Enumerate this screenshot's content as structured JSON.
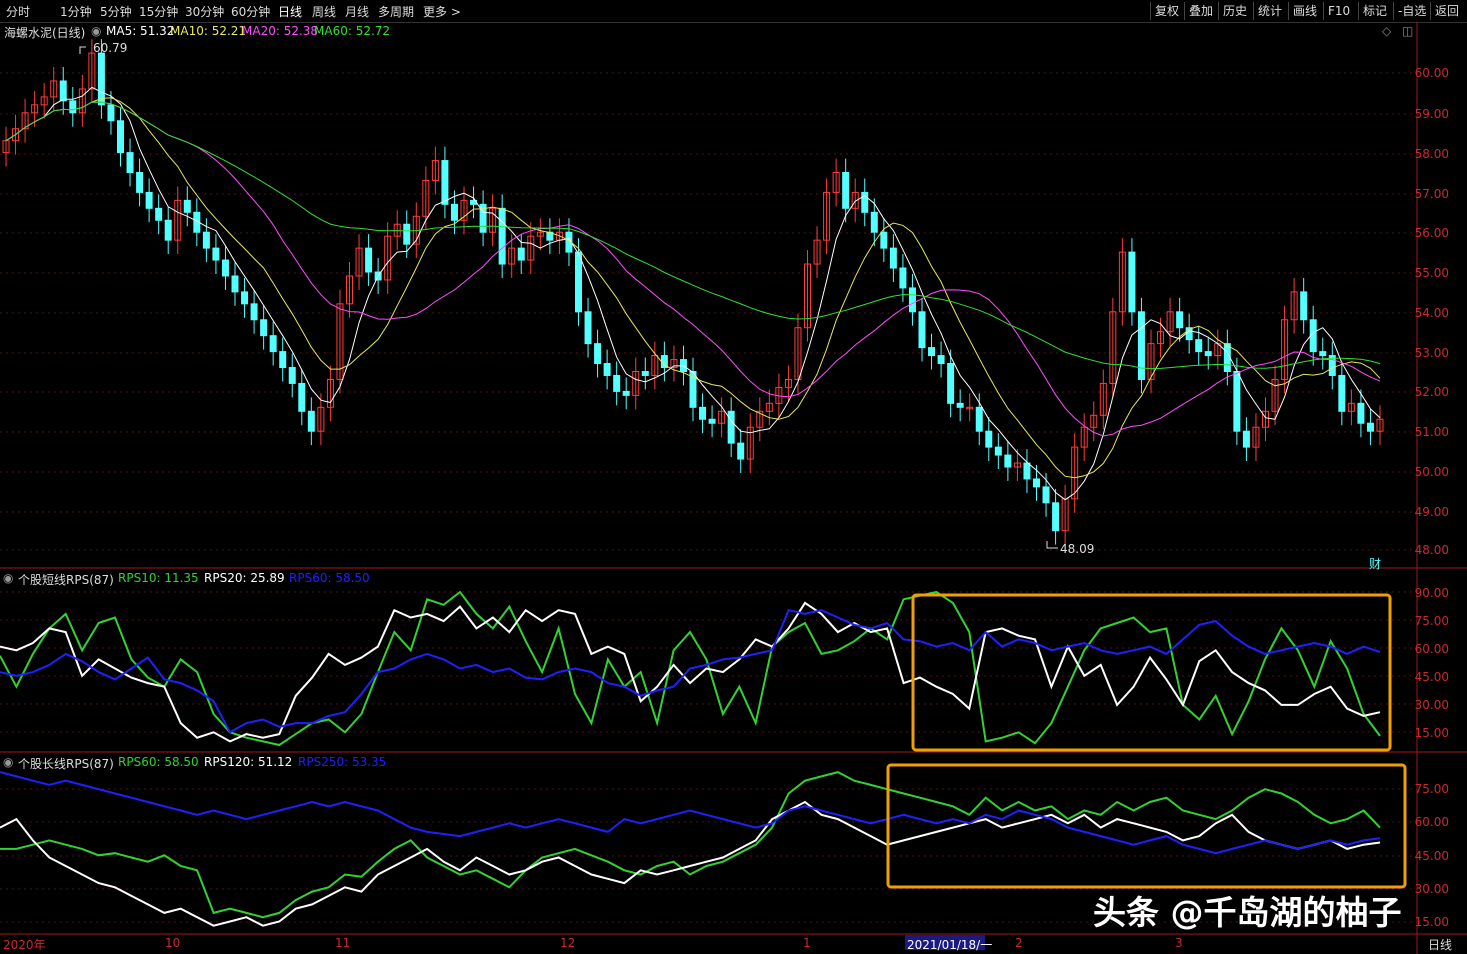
{
  "toolbar": {
    "periods": [
      "分时",
      "1分钟",
      "5分钟",
      "15分钟",
      "30分钟",
      "60分钟",
      "日线",
      "周线",
      "月线",
      "多周期",
      "更多 >"
    ],
    "active_index": 6,
    "right_buttons": [
      "复权",
      "叠加",
      "历史",
      "统计",
      "画线",
      "F10",
      "标记",
      "-自选",
      "返回"
    ]
  },
  "main": {
    "stock_title": "海螺水泥(日线)",
    "ma5": "MA5: 51.32",
    "ma10": "MA10: 52.21",
    "ma20": "MA20: 52.38",
    "ma60": "MA60: 52.72",
    "high_mark": "60.79",
    "low_mark": "48.09",
    "fin_label": "财",
    "price_axis": [
      "60.00",
      "59.00",
      "58.00",
      "57.00",
      "56.00",
      "55.00",
      "54.00",
      "53.00",
      "52.00",
      "51.00",
      "50.00",
      "49.00",
      "48.00"
    ]
  },
  "panel1": {
    "title": "个股短线RPS(87)",
    "rps10": "RPS10: 11.35",
    "rps20": "RPS20: 25.89",
    "rps60": "RPS60: 58.50",
    "axis": [
      "90.00",
      "75.00",
      "60.00",
      "45.00",
      "30.00",
      "15.00"
    ]
  },
  "panel2": {
    "title": "个股长线RPS(87)",
    "rps60": "RPS60: 58.50",
    "rps120": "RPS120: 51.12",
    "rps250": "RPS250: 53.35",
    "axis": [
      "75.00",
      "60.00",
      "45.00",
      "30.00",
      "15.00"
    ]
  },
  "dates": {
    "year": "2020年",
    "m10": "10",
    "m11": "11",
    "m12": "12",
    "m1": "1",
    "cursor": "2021/01/18/一",
    "m2": "2",
    "m3": "3",
    "period_label": "日线"
  },
  "watermark": "头条 @千岛湖的柚子",
  "colors": {
    "up": "#ff3c3c",
    "down": "#54ffff",
    "ma5": "#ffffff",
    "ma10": "#e8e85a",
    "ma20": "#ff4cff",
    "ma60": "#30e030",
    "rps_green": "#32d232",
    "rps_white": "#ffffff",
    "rps_blue": "#2020ff",
    "highlight_box": "#f0a000"
  }
}
